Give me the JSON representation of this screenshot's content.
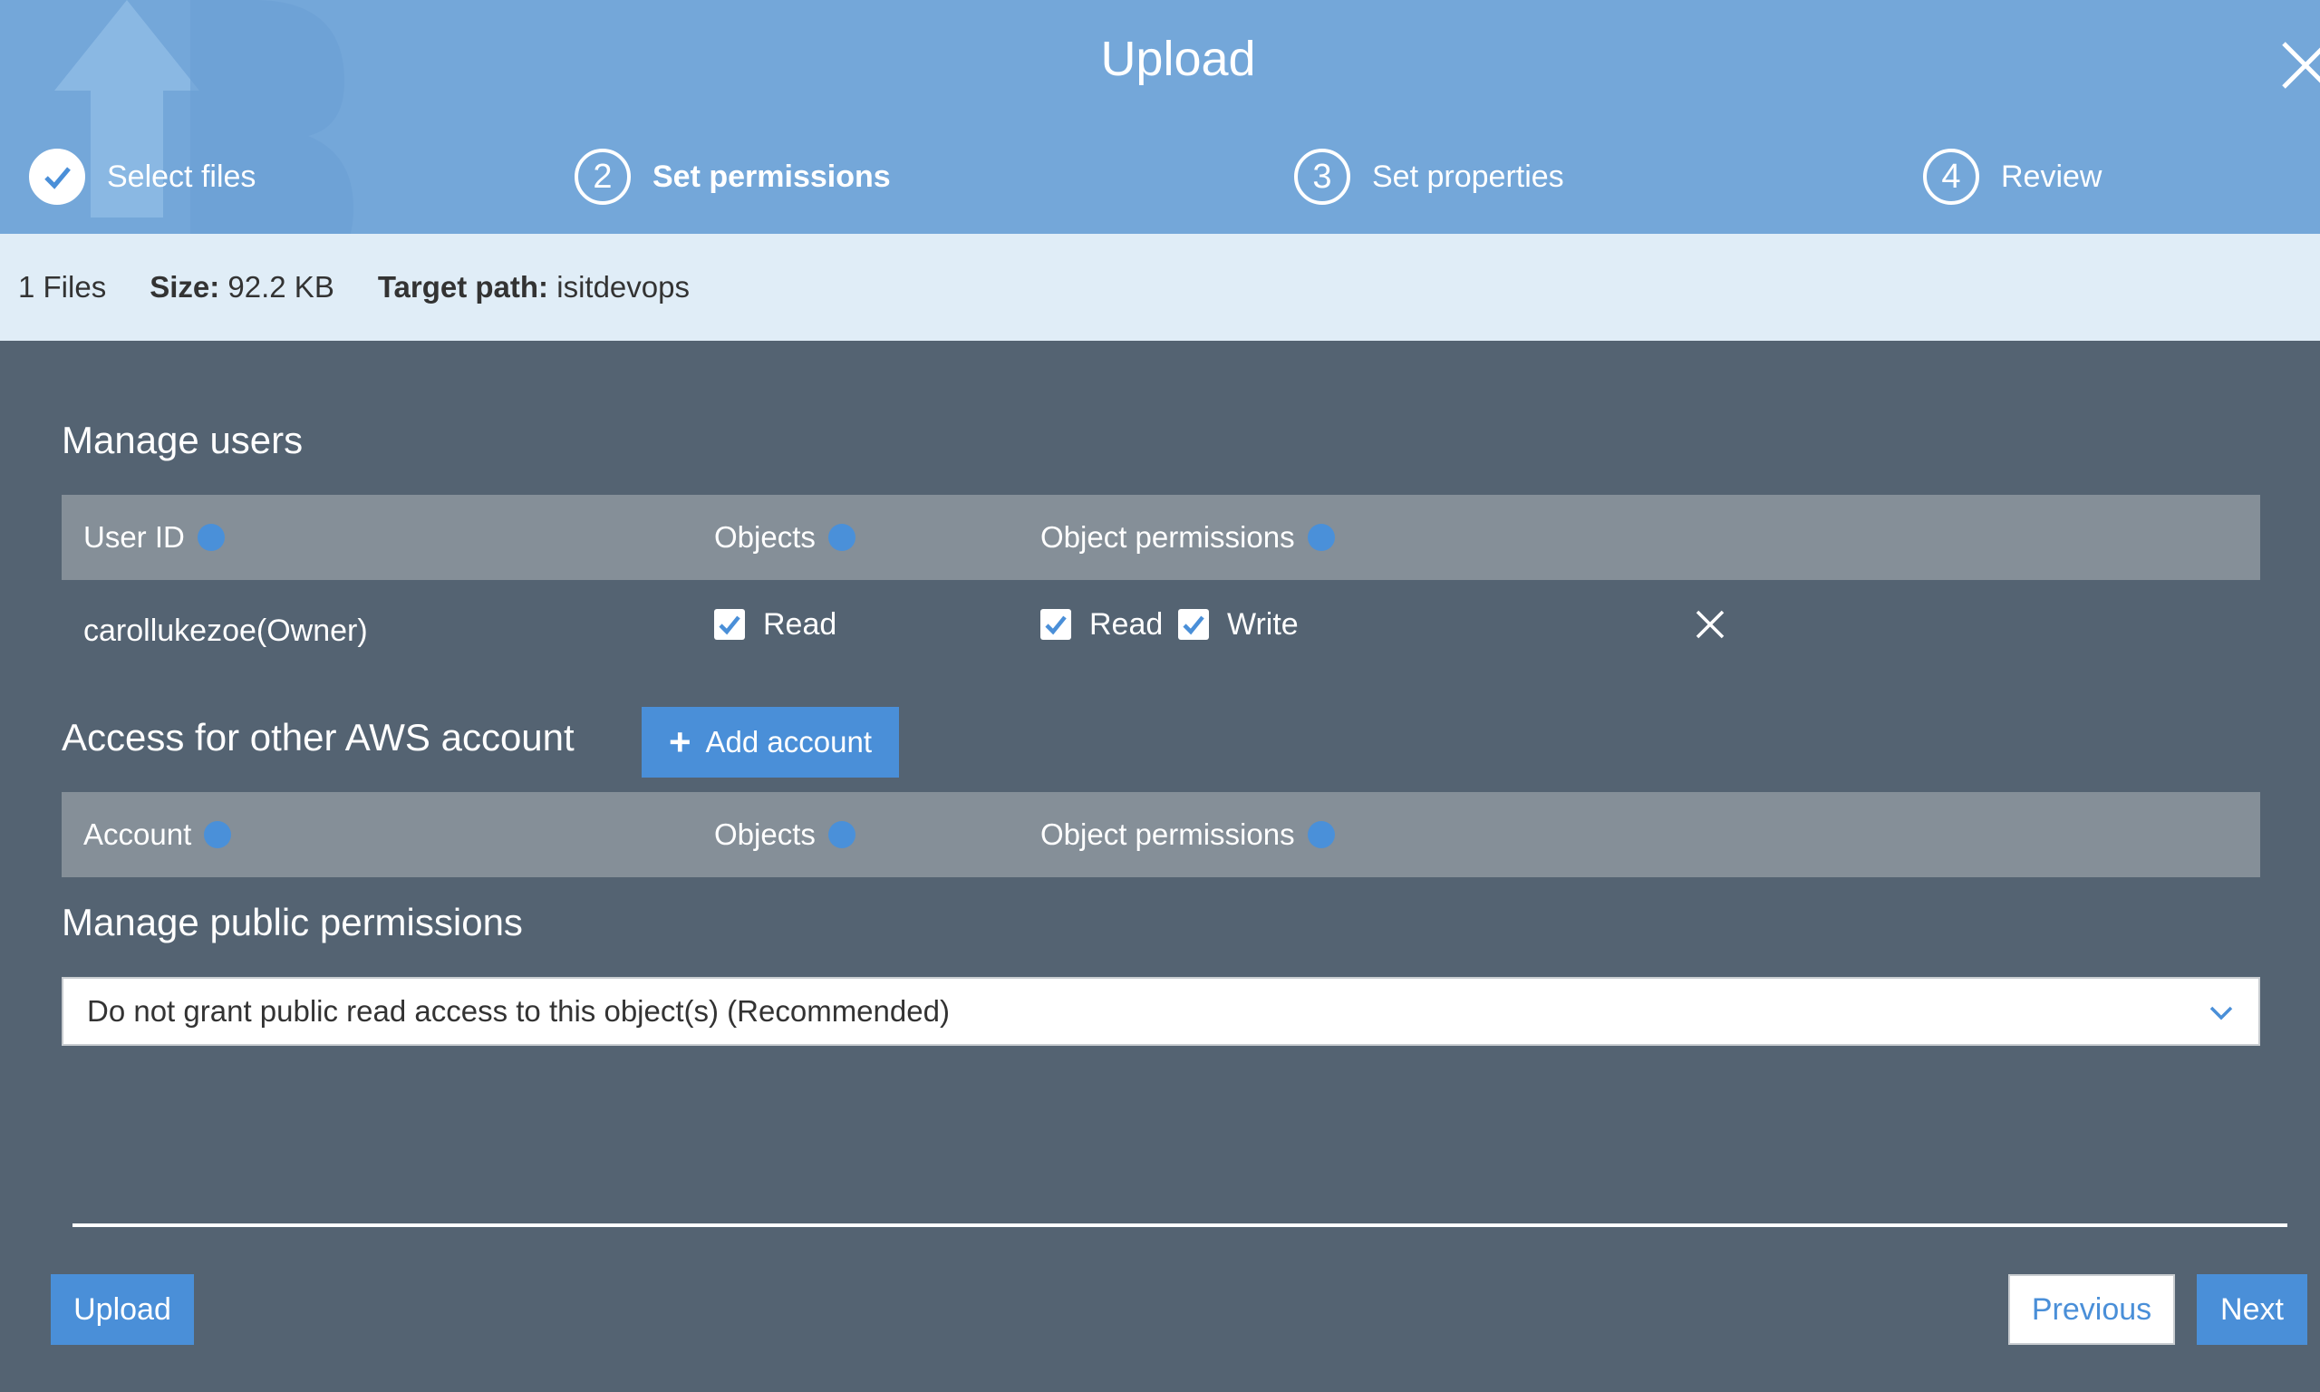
{
  "header": {
    "title": "Upload",
    "steps": [
      {
        "number": "",
        "label": "Select files",
        "state": "done"
      },
      {
        "number": "2",
        "label": "Set permissions",
        "state": "active"
      },
      {
        "number": "3",
        "label": "Set properties",
        "state": "pending"
      },
      {
        "number": "4",
        "label": "Review",
        "state": "pending"
      }
    ]
  },
  "info": {
    "files": "1 Files",
    "size_label": "Size:",
    "size_value": "92.2 KB",
    "target_label": "Target path:",
    "target_value": "isitdevops"
  },
  "manage_users": {
    "heading": "Manage users",
    "columns": {
      "user_id": "User ID",
      "objects": "Objects",
      "object_permissions": "Object permissions"
    },
    "rows": [
      {
        "user": "carollukezoe(Owner)",
        "objects_read": "Read",
        "perm_read": "Read",
        "perm_write": "Write"
      }
    ]
  },
  "other_accounts": {
    "heading": "Access for other AWS account",
    "add_button": "Add account",
    "columns": {
      "account": "Account",
      "objects": "Objects",
      "object_permissions": "Object permissions"
    }
  },
  "public_permissions": {
    "heading": "Manage public permissions",
    "selected": "Do not grant public read access to this object(s) (Recommended)"
  },
  "footer": {
    "upload": "Upload",
    "previous": "Previous",
    "next": "Next"
  },
  "colors": {
    "header_bg": "#74a7d9",
    "body_bg": "#546372",
    "accent": "#4a8fd8",
    "info_bar": "#e0edf7"
  }
}
